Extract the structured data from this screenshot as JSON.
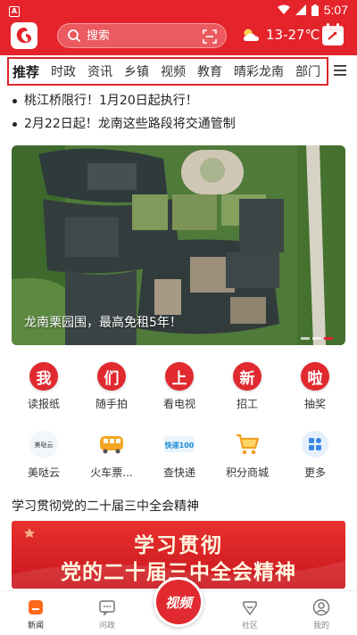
{
  "status_bar": {
    "time": "5:07",
    "badge": "A"
  },
  "header": {
    "search_placeholder": "搜索",
    "weather": "13-27℃",
    "colors": {
      "brand_red": "#e5232a"
    }
  },
  "tabs": [
    "推荐",
    "时政",
    "资讯",
    "乡镇",
    "视频",
    "教育",
    "晴彩龙南",
    "部门"
  ],
  "headlines": [
    "桃江桥限行！1月20日起执行！",
    "2月22日起！龙南这些路段将交通管制"
  ],
  "banner": {
    "caption": "龙南栗园围，最高免租5年！",
    "slide_count": 3,
    "active_slide": 3
  },
  "quick_row1": [
    {
      "glyph": "我",
      "label": "读报纸"
    },
    {
      "glyph": "们",
      "label": "随手拍"
    },
    {
      "glyph": "上",
      "label": "看电视"
    },
    {
      "glyph": "新",
      "label": "招工"
    },
    {
      "glyph": "啦",
      "label": "抽奖"
    }
  ],
  "quick_row2": [
    {
      "icon": "meidayun-logo-icon",
      "logo_text": "美哒云",
      "label": "美哒云"
    },
    {
      "icon": "train-icon",
      "label": "火车票..."
    },
    {
      "icon": "express-logo-icon",
      "logo_text": "快递100",
      "label": "查快递"
    },
    {
      "icon": "shopping-cart-icon",
      "label": "积分商城"
    },
    {
      "icon": "more-apps-icon",
      "label": "更多"
    }
  ],
  "section": {
    "title": "学习贯彻党的二十届三中全会精神",
    "promo_line1": "学习贯彻",
    "promo_line2": "党的二十届三中全会精神"
  },
  "bottom_nav": {
    "news": "新闻",
    "wenzheng": "问政",
    "video": "视频",
    "community": "社区",
    "mine": "我的"
  }
}
